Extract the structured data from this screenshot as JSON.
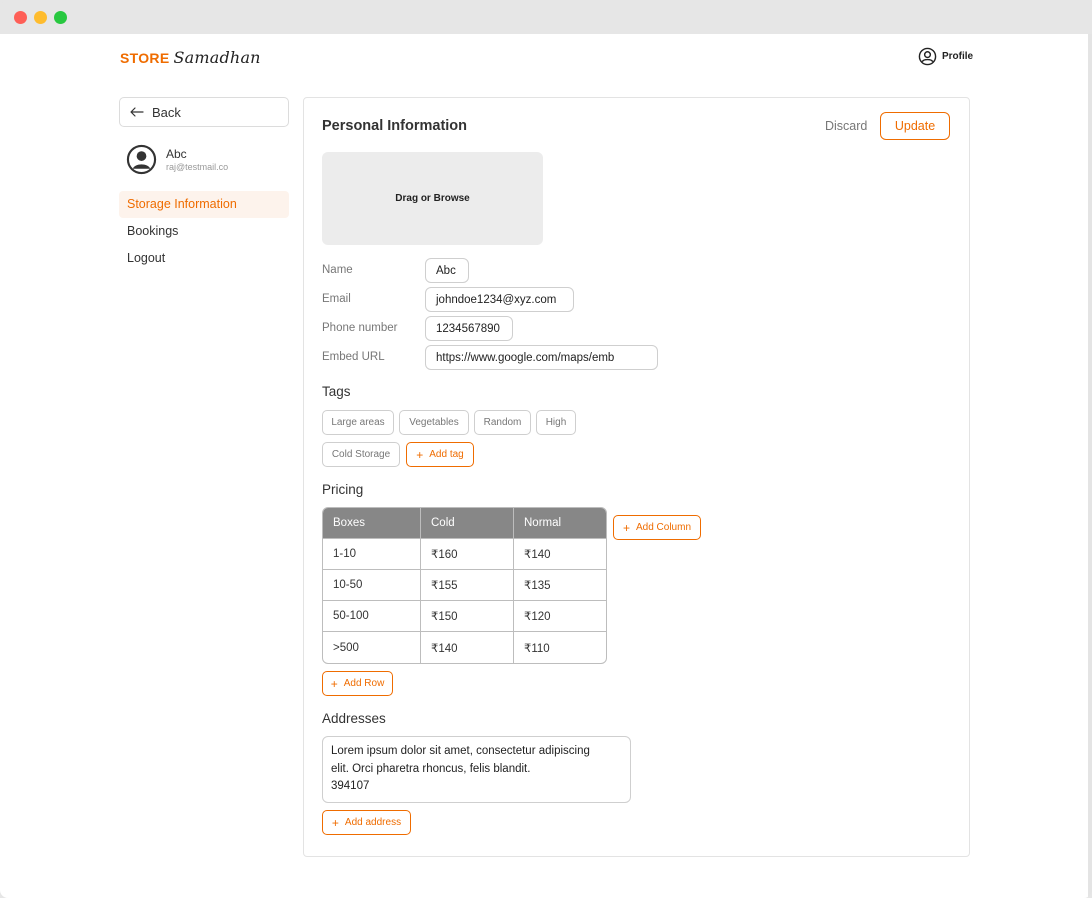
{
  "header": {
    "logo_store": "STORE",
    "logo_script": "Samadhan",
    "profile_label": "Profile"
  },
  "sidebar": {
    "back_label": "Back",
    "user": {
      "name": "Abc",
      "email": "raj@testmail.co"
    },
    "items": [
      {
        "label": "Storage Information",
        "active": true
      },
      {
        "label": "Bookings",
        "active": false
      },
      {
        "label": "Logout",
        "active": false
      }
    ]
  },
  "main": {
    "title": "Personal Information",
    "discard_label": "Discard",
    "update_label": "Update",
    "upload_label": "Drag or Browse",
    "fields": [
      {
        "label": "Name",
        "value": "Abc"
      },
      {
        "label": "Email",
        "value": "johndoe1234@xyz.com"
      },
      {
        "label": "Phone number",
        "value": "1234567890"
      },
      {
        "label": "Embed URL",
        "value": "https://www.google.com/maps/emb"
      }
    ],
    "tags_title": "Tags",
    "tags": [
      "Large areas",
      "Vegetables",
      "Random",
      "High",
      "Cold Storage"
    ],
    "add_tag_label": "Add tag",
    "pricing_title": "Pricing",
    "pricing": {
      "headers": [
        "Boxes",
        "Cold",
        "Normal"
      ],
      "rows": [
        [
          "1-10",
          "₹160",
          "₹140"
        ],
        [
          "10-50",
          "₹155",
          "₹135"
        ],
        [
          "50-100",
          "₹150",
          "₹120"
        ],
        [
          ">500",
          "₹140",
          "₹110"
        ]
      ]
    },
    "add_column_label": "Add Column",
    "add_row_label": "Add Row",
    "addresses_title": "Addresses",
    "address_lines": [
      "Lorem ipsum dolor sit amet, consectetur adipiscing",
      "elit. Orci pharetra rhoncus, felis blandit.",
      "394107"
    ],
    "add_address_label": "Add address"
  },
  "colors": {
    "accent": "#ef6c00",
    "table_header": "#878787",
    "active_nav_bg": "#fdf3ec"
  }
}
